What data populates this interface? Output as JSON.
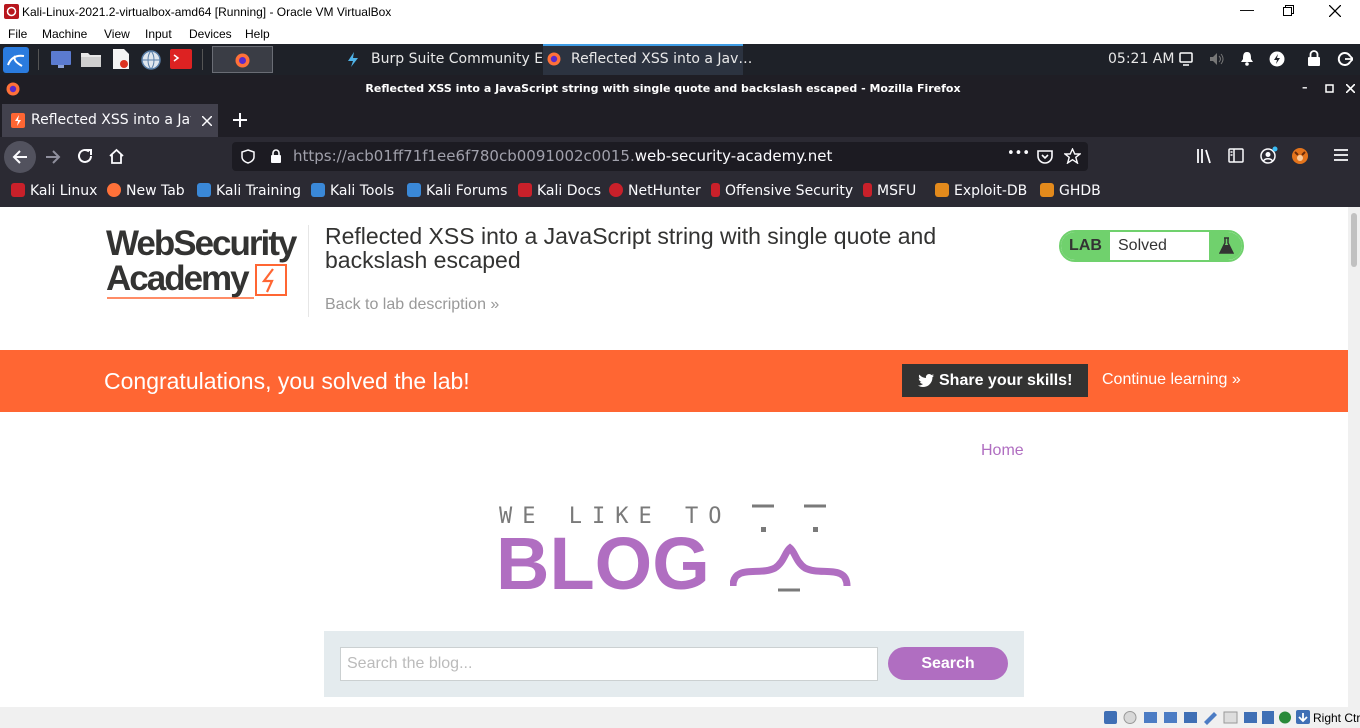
{
  "vbox": {
    "title": "Kali-Linux-2021.2-virtualbox-amd64 [Running] - Oracle VM VirtualBox",
    "menu": [
      "File",
      "Machine",
      "View",
      "Input",
      "Devices",
      "Help"
    ],
    "host_key": "Right Ctrl"
  },
  "panel": {
    "tasks": [
      "Burp Suite Community E…",
      "Reflected XSS into a Jav…"
    ],
    "clock": "05:21 AM"
  },
  "firefox": {
    "window_title": "Reflected XSS into a JavaScript string with single quote and backslash escaped - Mozilla Firefox",
    "tab_title": "Reflected XSS into a Java",
    "url_prefix": "https://acb01ff71f1ee6f780cb0091002c0015.",
    "url_domain": "web-security-academy.net",
    "url_more": "•••",
    "bookmarks": [
      "Kali Linux",
      "New Tab",
      "Kali Training",
      "Kali Tools",
      "Kali Forums",
      "Kali Docs",
      "NetHunter",
      "Offensive Security",
      "MSFU",
      "Exploit-DB",
      "GHDB"
    ]
  },
  "lab": {
    "logo_line1": "WebSecurity",
    "logo_line2": "Academy",
    "title": "Reflected XSS into a JavaScript string with single quote and backslash escaped",
    "back_link": "Back to lab description »",
    "badge_label": "LAB",
    "status": "Solved",
    "congrats": "Congratulations, you solved the lab!",
    "share": "Share your skills!",
    "continue": "Continue learning »"
  },
  "blog": {
    "home_link": "Home",
    "banner_small": "WE LIKE TO",
    "banner_big": "BLOG",
    "search_placeholder": "Search the blog...",
    "search_button": "Search"
  },
  "colors": {
    "solved_green": "#70d16d",
    "orange": "#ff6633",
    "purple": "#b06ec1"
  }
}
